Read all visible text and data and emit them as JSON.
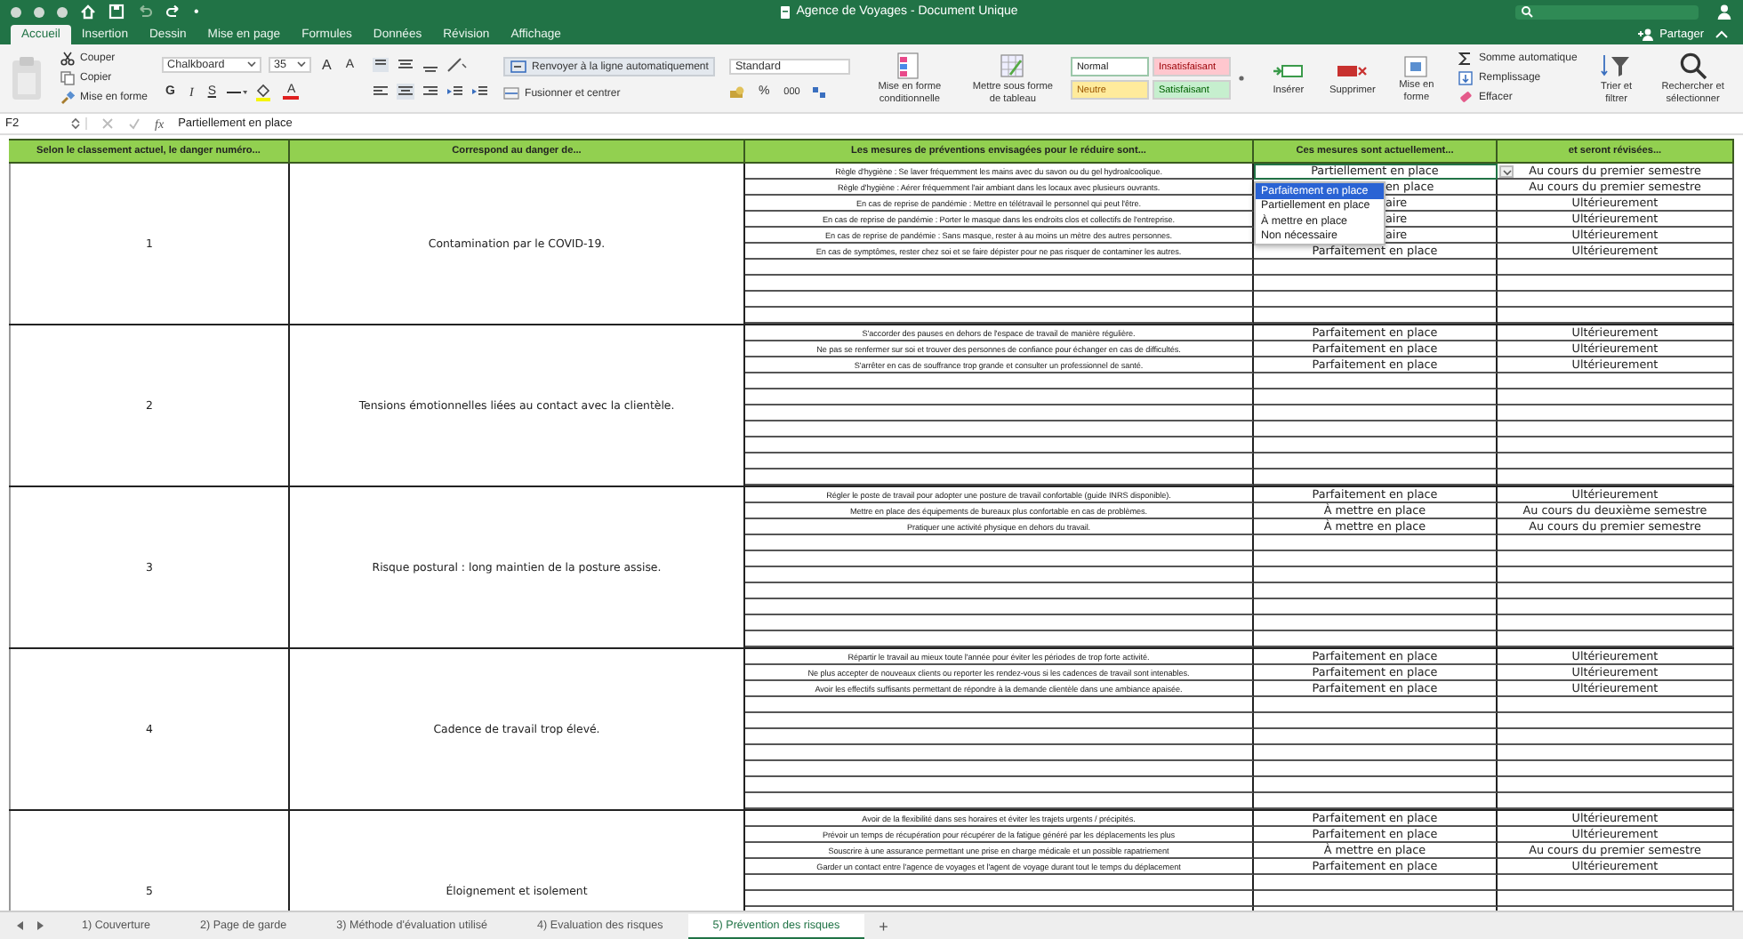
{
  "title_bar": {
    "title": "Agence de Voyages - Document Unique",
    "more": "•"
  },
  "ribbon_tabs": [
    {
      "label": "Accueil",
      "selected": true
    },
    {
      "label": "Insertion",
      "selected": false
    },
    {
      "label": "Dessin",
      "selected": false
    },
    {
      "label": "Mise en page",
      "selected": false
    },
    {
      "label": "Formules",
      "selected": false
    },
    {
      "label": "Données",
      "selected": false
    },
    {
      "label": "Révision",
      "selected": false
    },
    {
      "label": "Affichage",
      "selected": false
    }
  ],
  "share": "Partager",
  "ribbon": {
    "clipboard": [
      "Couper",
      "Copier",
      "Mise en forme"
    ],
    "font": {
      "name": "Chalkboard",
      "size": "35",
      "grow": "A",
      "shrink": "A",
      "styles": [
        "G",
        "I",
        "S"
      ],
      "color_letter": "A"
    },
    "wrap_text": "Renvoyer à la ligne automatiquement",
    "merge": "Fusionner et centrer",
    "number_format": "Standard",
    "percent": "%",
    "thousands": "000",
    "conditional": "Mise en forme conditionnelle",
    "as_table": "Mettre sous forme de tableau",
    "styles": [
      {
        "label": "Normal",
        "kind": "normal"
      },
      {
        "label": "Insatisfaisant",
        "kind": "bad"
      },
      {
        "label": "Neutre",
        "kind": "neutral"
      },
      {
        "label": "Satisfaisant",
        "kind": "good"
      }
    ],
    "cells": [
      "Insérer",
      "Supprimer",
      "Mise en forme"
    ],
    "editing": [
      "Somme automatique",
      "Remplissage",
      "Effacer"
    ],
    "sort": "Trier et filtrer",
    "find": "Rechercher et sélectionner"
  },
  "formula_bar": {
    "cell": "F2",
    "fx": "fx",
    "value": "Partiellement en place"
  },
  "table": {
    "columns": [
      "Selon le classement actuel, le danger numéro...",
      "Correspond au danger de...",
      "Les mesures de préventions envisagées pour le réduire sont...",
      "Ces mesures sont actuellement...",
      "et seront révisées..."
    ],
    "groups": [
      {
        "number": "1",
        "danger": "Contamination par le COVID-19.",
        "measures": [
          {
            "text": "Règle d'hygiène : Se laver fréquemment les mains avec du savon ou du gel hydroalcoolique.",
            "status": "Partiellement en place",
            "revision": "Au cours du premier semestre",
            "selected": true
          },
          {
            "text": "Règle d'hygiène : Aérer fréquemment l'air ambiant dans les locaux avec plusieurs ouvrants.",
            "status": "en place",
            "revision": "Au cours du premier semestre",
            "selected": false
          },
          {
            "text": "En cas de reprise de pandémie : Mettre en télétravail le personnel qui peut l'être.",
            "status": "aire",
            "revision": "Ultérieurement",
            "selected": false
          },
          {
            "text": "En cas de reprise de pandémie : Porter le masque dans les endroits clos et collectifs de l'entreprise.",
            "status": "aire",
            "revision": "Ultérieurement",
            "selected": false
          },
          {
            "text": "En cas de reprise de pandémie : Sans masque, rester à au moins un mètre des autres personnes.",
            "status": "aire",
            "revision": "Ultérieurement",
            "selected": false
          },
          {
            "text": "En cas de symptômes, rester chez soi et se faire dépister pour ne pas risquer de contaminer les autres.",
            "status": "Parfaitement en place",
            "revision": "Ultérieurement",
            "selected": false
          }
        ]
      },
      {
        "number": "2",
        "danger": "Tensions émotionnelles liées au contact avec la clientèle.",
        "measures": [
          {
            "text": "S'accorder des pauses en dehors de l'espace de travail de manière régulière.",
            "status": "Parfaitement en place",
            "revision": "Ultérieurement",
            "selected": false
          },
          {
            "text": "Ne pas se renfermer sur soi et trouver des personnes de confiance pour échanger en cas de difficultés.",
            "status": "Parfaitement en place",
            "revision": "Ultérieurement",
            "selected": false
          },
          {
            "text": "S'arrêter en cas de souffrance trop grande et consulter un professionnel de santé.",
            "status": "Parfaitement en place",
            "revision": "Ultérieurement",
            "selected": false
          }
        ]
      },
      {
        "number": "3",
        "danger": "Risque postural : long maintien de la posture assise.",
        "measures": [
          {
            "text": "Régler le poste de travail pour adopter une posture de travail confortable (guide INRS disponible).",
            "status": "Parfaitement en place",
            "revision": "Ultérieurement",
            "selected": false
          },
          {
            "text": "Mettre en place des équipements de bureaux plus confortable en cas de problèmes.",
            "status": "À mettre en place",
            "revision": "Au cours du deuxième semestre",
            "selected": false
          },
          {
            "text": "Pratiquer une activité physique en dehors du travail.",
            "status": "À mettre en place",
            "revision": "Au cours du premier semestre",
            "selected": false
          }
        ]
      },
      {
        "number": "4",
        "danger": "Cadence de travail trop élevé.",
        "measures": [
          {
            "text": "Répartir le travail au mieux toute l'année pour éviter les périodes de trop forte activité.",
            "status": "Parfaitement en place",
            "revision": "Ultérieurement",
            "selected": false
          },
          {
            "text": "Ne plus accepter de nouveaux clients ou reporter les rendez-vous si les cadences de travail sont intenables.",
            "status": "Parfaitement en place",
            "revision": "Ultérieurement",
            "selected": false
          },
          {
            "text": "Avoir les effectifs suffisants permettant de répondre à la demande clientèle dans une ambiance apaisée.",
            "status": "Parfaitement en place",
            "revision": "Ultérieurement",
            "selected": false
          }
        ]
      },
      {
        "number": "5",
        "danger": "Éloignement et isolement",
        "measures": [
          {
            "text": "Avoir de la flexibilité dans ses horaires et éviter les trajets urgents / précipités.",
            "status": "Parfaitement en place",
            "revision": "Ultérieurement",
            "selected": false
          },
          {
            "text": "Prévoir un temps de récupération pour récupérer de la fatigue généré par les déplacements les plus",
            "status": "Parfaitement en place",
            "revision": "Ultérieurement",
            "selected": false
          },
          {
            "text": "Souscrire à une assurance permettant une prise en charge médicale et un possible rapatriement",
            "status": "À mettre en place",
            "revision": "Au cours du premier semestre",
            "selected": false
          },
          {
            "text": "Garder un contact entre l'agence de voyages et l'agent de voyage durant tout le temps du déplacement",
            "status": "Parfaitement en place",
            "revision": "Ultérieurement",
            "selected": false
          }
        ]
      }
    ]
  },
  "dropdown": {
    "options": [
      {
        "label": "Parfaitement en place",
        "selected": true
      },
      {
        "label": "Partiellement en place",
        "selected": false
      },
      {
        "label": "À mettre en place",
        "selected": false
      },
      {
        "label": "Non nécessaire",
        "selected": false
      }
    ]
  },
  "sheet_tabs": [
    {
      "label": "1) Couverture",
      "selected": false
    },
    {
      "label": "2) Page de garde",
      "selected": false
    },
    {
      "label": "3) Méthode d'évaluation utilisé",
      "selected": false
    },
    {
      "label": "4) Evaluation des risques",
      "selected": false
    },
    {
      "label": "5) Prévention des risques",
      "selected": true
    }
  ],
  "add_sheet": "+"
}
